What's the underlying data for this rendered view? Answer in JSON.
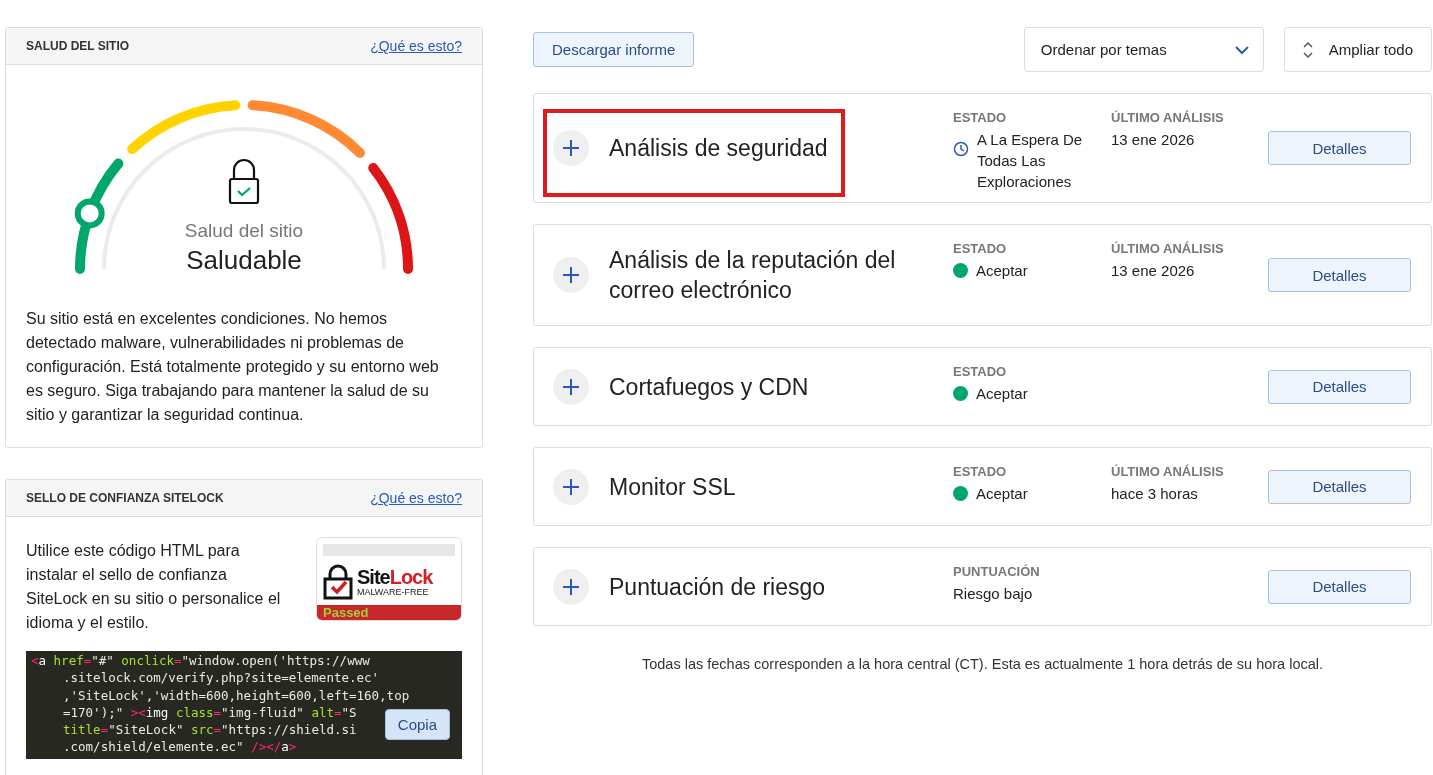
{
  "site_health": {
    "title": "SALUD DEL SITIO",
    "help_link": "¿Qué es esto?",
    "gauge": {
      "level": 0.11,
      "label": "Salud del sitio",
      "value": "Saludable"
    },
    "description": "Su sitio está en excelentes condiciones. No hemos detectado malware, vulnerabilidades ni problemas de configuración. Está totalmente protegido y su entorno web es seguro. Siga trabajando para mantener la salud de su sitio y garantizar la seguridad continua."
  },
  "trust_seal": {
    "title": "SELLO DE CONFIANZA SITELOCK",
    "help_link": "¿Qué es esto?",
    "description": "Utilice este código HTML para instalar el sello de confianza SiteLock en su sitio o personalice el idioma y el estilo.",
    "badge": {
      "brand_first": "Site",
      "brand_second": "Lock",
      "tagline": "MALWARE-FREE",
      "status": "Passed"
    },
    "code_lines": [
      [
        {
          "kind": "punct",
          "text": "<"
        },
        {
          "kind": "name",
          "text": "a"
        },
        {
          "kind": "attr",
          "text": " href"
        },
        {
          "kind": "punct",
          "text": "="
        },
        {
          "kind": "str",
          "text": "\"#\""
        },
        {
          "kind": "attr",
          "text": " onclick"
        },
        {
          "kind": "punct",
          "text": "="
        },
        {
          "kind": "str",
          "text": "\"window.open('https://www"
        }
      ],
      [
        {
          "kind": "str",
          "text": ".sitelock.com/verify.php?site=elemente.ec'"
        }
      ],
      [
        {
          "kind": "str",
          "text": ",'SiteLock','width=600,height=600,left=160,top"
        }
      ],
      [
        {
          "kind": "str",
          "text": "=170');\" "
        },
        {
          "kind": "punct",
          "text": "><"
        },
        {
          "kind": "name",
          "text": "img"
        },
        {
          "kind": "attr",
          "text": " class"
        },
        {
          "kind": "punct",
          "text": "="
        },
        {
          "kind": "str",
          "text": "\"img-fluid\""
        },
        {
          "kind": "attr",
          "text": " alt"
        },
        {
          "kind": "punct",
          "text": "="
        },
        {
          "kind": "str",
          "text": "\"S"
        }
      ],
      [
        {
          "kind": "attr",
          "text": "title"
        },
        {
          "kind": "punct",
          "text": "="
        },
        {
          "kind": "str",
          "text": "\"SiteLock\""
        },
        {
          "kind": "attr",
          "text": " src"
        },
        {
          "kind": "punct",
          "text": "="
        },
        {
          "kind": "str",
          "text": "\"https://shield.si"
        }
      ],
      [
        {
          "kind": "str",
          "text": ".com/shield/elemente.ec\" "
        },
        {
          "kind": "punct",
          "text": "/></"
        },
        {
          "kind": "name",
          "text": "a"
        },
        {
          "kind": "punct",
          "text": ">"
        }
      ]
    ],
    "copy_button": "Copia"
  },
  "toolbar": {
    "download": "Descargar informe",
    "sort": "Ordenar por temas",
    "expand": "Ampliar todo"
  },
  "checks": [
    {
      "title": "Análisis de seguridad",
      "highlighted": true,
      "status": {
        "label": "ESTADO",
        "kind": "waiting",
        "value": "A La Espera De Todas Las Exploraciones"
      },
      "last_scan": {
        "label": "ÚLTIMO ANÁLISIS",
        "value": "13 ene 2026"
      },
      "button": "Detalles"
    },
    {
      "title": "Análisis de la reputación del correo electrónico",
      "highlighted": false,
      "status": {
        "label": "ESTADO",
        "kind": "ok",
        "value": "Aceptar"
      },
      "last_scan": {
        "label": "ÚLTIMO ANÁLISIS",
        "value": "13 ene 2026"
      },
      "button": "Detalles"
    },
    {
      "title": "Cortafuegos y CDN",
      "highlighted": false,
      "status": {
        "label": "ESTADO",
        "kind": "ok",
        "value": "Aceptar"
      },
      "button": "Detalles"
    },
    {
      "title": "Monitor SSL",
      "highlighted": false,
      "status": {
        "label": "ESTADO",
        "kind": "ok",
        "value": "Aceptar"
      },
      "last_scan": {
        "label": "ÚLTIMO ANÁLISIS",
        "value": "hace 3 horas"
      },
      "button": "Detalles"
    },
    {
      "title": "Puntuación de riesgo",
      "highlighted": false,
      "status": {
        "label": "PUNTUACIÓN",
        "kind": "plain",
        "value": "Riesgo bajo"
      },
      "button": "Detalles"
    }
  ],
  "footnote": "Todas las fechas corresponden a la hora central (CT). Esta es actualmente 1 hora detrás de su hora local."
}
